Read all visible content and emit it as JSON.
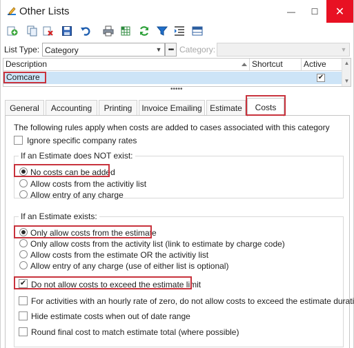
{
  "window": {
    "title": "Other Lists",
    "minimize_glyph": "—",
    "maximize_glyph": "☐",
    "close_glyph": "✕"
  },
  "toolbar": {
    "icons": [
      "add-icon",
      "copy-icon",
      "delete-icon",
      "save-icon",
      "undo-icon",
      "print-icon",
      "export-icon",
      "refresh-icon",
      "filter-icon",
      "indent-icon",
      "layout-icon"
    ]
  },
  "filters": {
    "list_type_label": "List Type:",
    "list_type_value": "Category",
    "ellipsis": "•••",
    "category_label": "Category:",
    "category_value": ""
  },
  "grid": {
    "headers": {
      "description": "Description",
      "shortcut": "Shortcut",
      "active": "Active"
    },
    "rows": [
      {
        "description": "Comcare",
        "shortcut": "",
        "active": true
      }
    ]
  },
  "splitter": "•••••",
  "tabs": [
    "General",
    "Accounting",
    "Printing",
    "Invoice Emailing",
    "Estimate",
    "Costs"
  ],
  "active_tab": "Costs",
  "costs": {
    "intro": "The following rules apply when costs are added to cases associated with this category",
    "ignore_company_rates": {
      "label": "Ignore specific company rates",
      "checked": false
    },
    "no_estimate": {
      "title": "If an Estimate does NOT exist:",
      "options": [
        {
          "label": "No costs can be added",
          "selected": true
        },
        {
          "label": "Allow costs from the activitiy list",
          "selected": false
        },
        {
          "label": "Allow entry of any charge",
          "selected": false
        }
      ]
    },
    "estimate_exists": {
      "title": "If an Estimate exists:",
      "options": [
        {
          "label": "Only allow costs from the estimate",
          "selected": true
        },
        {
          "label": "Only allow costs from the activity list (link to estimate by charge code)",
          "selected": false
        },
        {
          "label": "Allow costs from the estimate OR the activitiy list",
          "selected": false
        },
        {
          "label": "Allow entry of any charge (use of either list is optional)",
          "selected": false
        }
      ],
      "checks": [
        {
          "label": "Do not allow costs to exceed the estimate limit",
          "checked": true
        },
        {
          "label": "For activities with an hourly rate of zero, do not allow costs to exceed the estimate duration",
          "checked": false
        },
        {
          "label": "Hide estimate costs when out of date range",
          "checked": false
        },
        {
          "label": "Round final cost to match estimate total (where possible)",
          "checked": false
        }
      ]
    }
  },
  "check_glyph": "✔",
  "colors": {
    "accent": "#1e7bd6",
    "highlight_border": "#c8323c",
    "selection": "#cde4f7",
    "close": "#e81123"
  }
}
